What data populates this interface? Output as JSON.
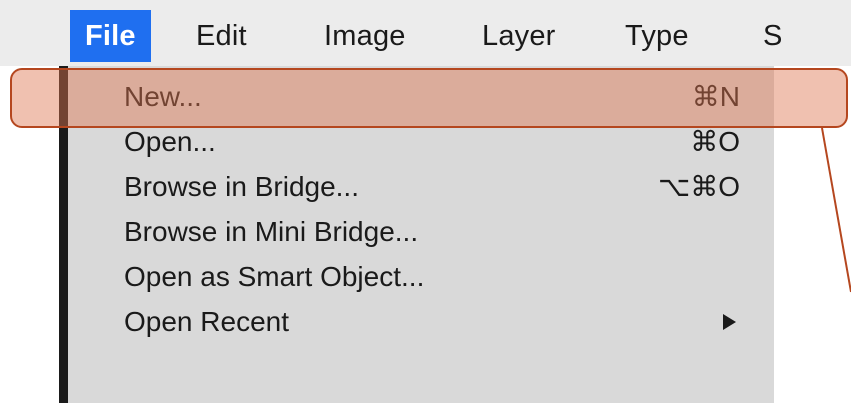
{
  "menubar": {
    "items": [
      {
        "label": "File",
        "active": true
      },
      {
        "label": "Edit",
        "active": false
      },
      {
        "label": "Image",
        "active": false
      },
      {
        "label": "Layer",
        "active": false
      },
      {
        "label": "Type",
        "active": false
      },
      {
        "label": "S",
        "active": false
      }
    ]
  },
  "file_menu": {
    "items": [
      {
        "label": "New...",
        "shortcut": "⌘N",
        "highlighted": true
      },
      {
        "label": "Open...",
        "shortcut": "⌘O"
      },
      {
        "label": "Browse in Bridge...",
        "shortcut": "⌥⌘O"
      },
      {
        "label": "Browse in Mini Bridge...",
        "shortcut": ""
      },
      {
        "label": "Open as Smart Object...",
        "shortcut": ""
      },
      {
        "label": "Open Recent",
        "shortcut": "",
        "submenu_icon": "triangle-right-icon"
      }
    ]
  },
  "colors": {
    "menu_active": "#1f6ff0",
    "menu_background": "#d9d9d9",
    "menubar_background": "#ececec",
    "highlight_fill": "#de7650",
    "highlight_border": "#b5471f"
  }
}
